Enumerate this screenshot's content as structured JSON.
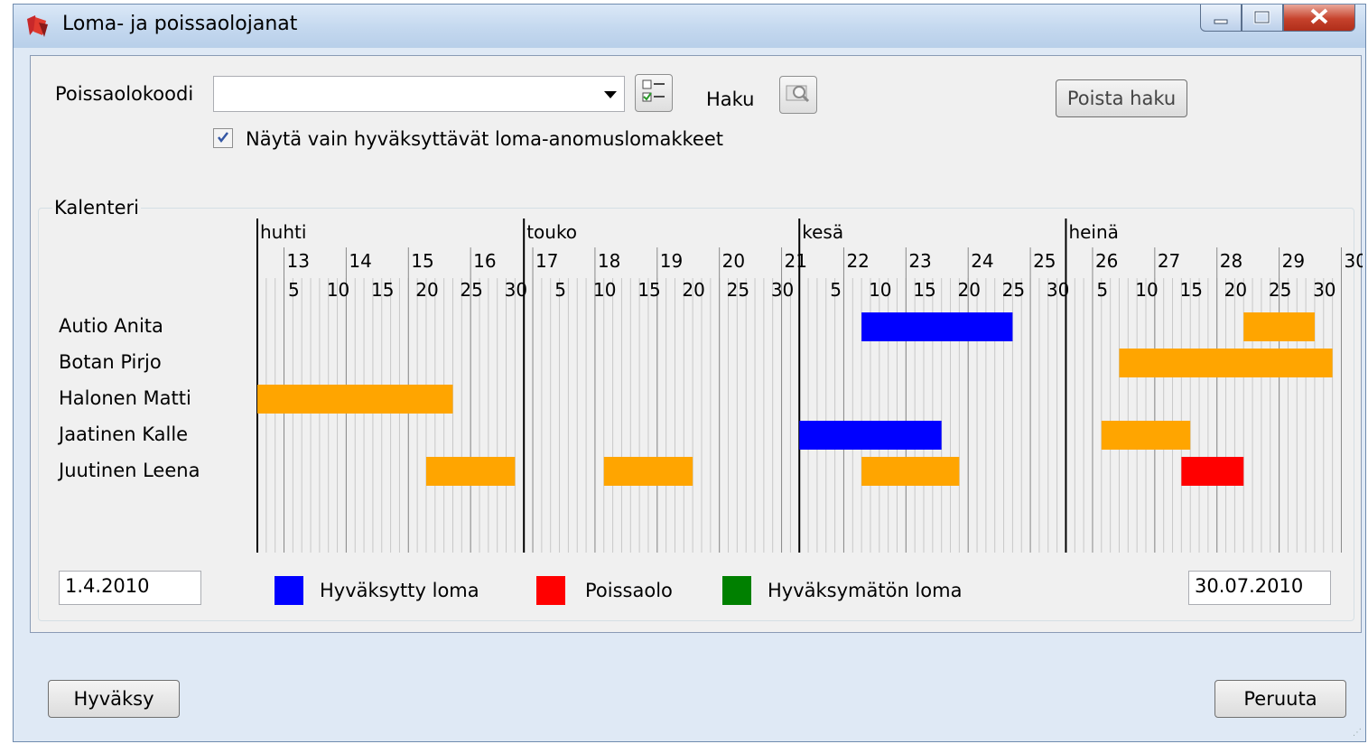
{
  "window": {
    "title": "Loma- ja poissaolojanat"
  },
  "filter": {
    "code_label": "Poissaolokoodi",
    "code_value": "",
    "search_label": "Haku",
    "clear_search_label": "Poista haku",
    "only_approvable_label": "Näytä vain hyväksyttävät loma-anomuslomakkeet",
    "only_approvable_checked": true
  },
  "calendar": {
    "group_label": "Kalenteri",
    "months": [
      "huhti",
      "touko",
      "kesä",
      "heinä"
    ],
    "weeks": [
      "13",
      "14",
      "15",
      "16",
      "17",
      "18",
      "19",
      "20",
      "21",
      "22",
      "23",
      "24",
      "25",
      "26",
      "27",
      "28",
      "29",
      "30"
    ],
    "day_ticks": [
      "5",
      "10",
      "15",
      "20",
      "25",
      "30",
      "5",
      "10",
      "15",
      "20",
      "25",
      "30",
      "5",
      "10",
      "15",
      "20",
      "25",
      "30",
      "5",
      "10",
      "15",
      "20",
      "25",
      "30"
    ],
    "people": [
      {
        "name": "Autio Anita",
        "bars": [
          {
            "status": "approved",
            "start": "2010-06-08",
            "end": "2010-06-24"
          },
          {
            "status": "pending",
            "start": "2010-07-21",
            "end": "2010-07-28"
          }
        ]
      },
      {
        "name": "Botan Pirjo",
        "bars": [
          {
            "status": "pending",
            "start": "2010-07-07",
            "end": "2010-07-30"
          }
        ]
      },
      {
        "name": "Halonen Matti",
        "bars": [
          {
            "status": "pending",
            "start": "2010-04-01",
            "end": "2010-04-22"
          }
        ]
      },
      {
        "name": "Jaatinen Kalle",
        "bars": [
          {
            "status": "approved",
            "start": "2010-06-01",
            "end": "2010-06-16"
          },
          {
            "status": "pending",
            "start": "2010-07-05",
            "end": "2010-07-14"
          }
        ]
      },
      {
        "name": "Juutinen Leena",
        "bars": [
          {
            "status": "pending",
            "start": "2010-04-20",
            "end": "2010-04-29"
          },
          {
            "status": "pending",
            "start": "2010-05-10",
            "end": "2010-05-19"
          },
          {
            "status": "pending",
            "start": "2010-06-08",
            "end": "2010-06-18"
          },
          {
            "status": "absence",
            "start": "2010-07-14",
            "end": "2010-07-20"
          }
        ]
      }
    ],
    "start_date": "1.4.2010",
    "end_date": "30.07.2010"
  },
  "legend": {
    "approved_label": "Hyväksytty loma",
    "absence_label": "Poissaolo",
    "unapproved_label": "Hyväksymätön loma"
  },
  "colors": {
    "approved": "#0000ff",
    "absence": "#ff0000",
    "unapproved": "#008000",
    "pending": "#ffa500"
  },
  "buttons": {
    "accept_label": "Hyväksy",
    "cancel_label": "Peruuta"
  },
  "icons": {
    "app": "app-icon",
    "list_picker": "checklist-icon",
    "search": "search-icon",
    "minimize": "minimize-icon",
    "maximize": "maximize-icon",
    "close": "close-icon"
  }
}
